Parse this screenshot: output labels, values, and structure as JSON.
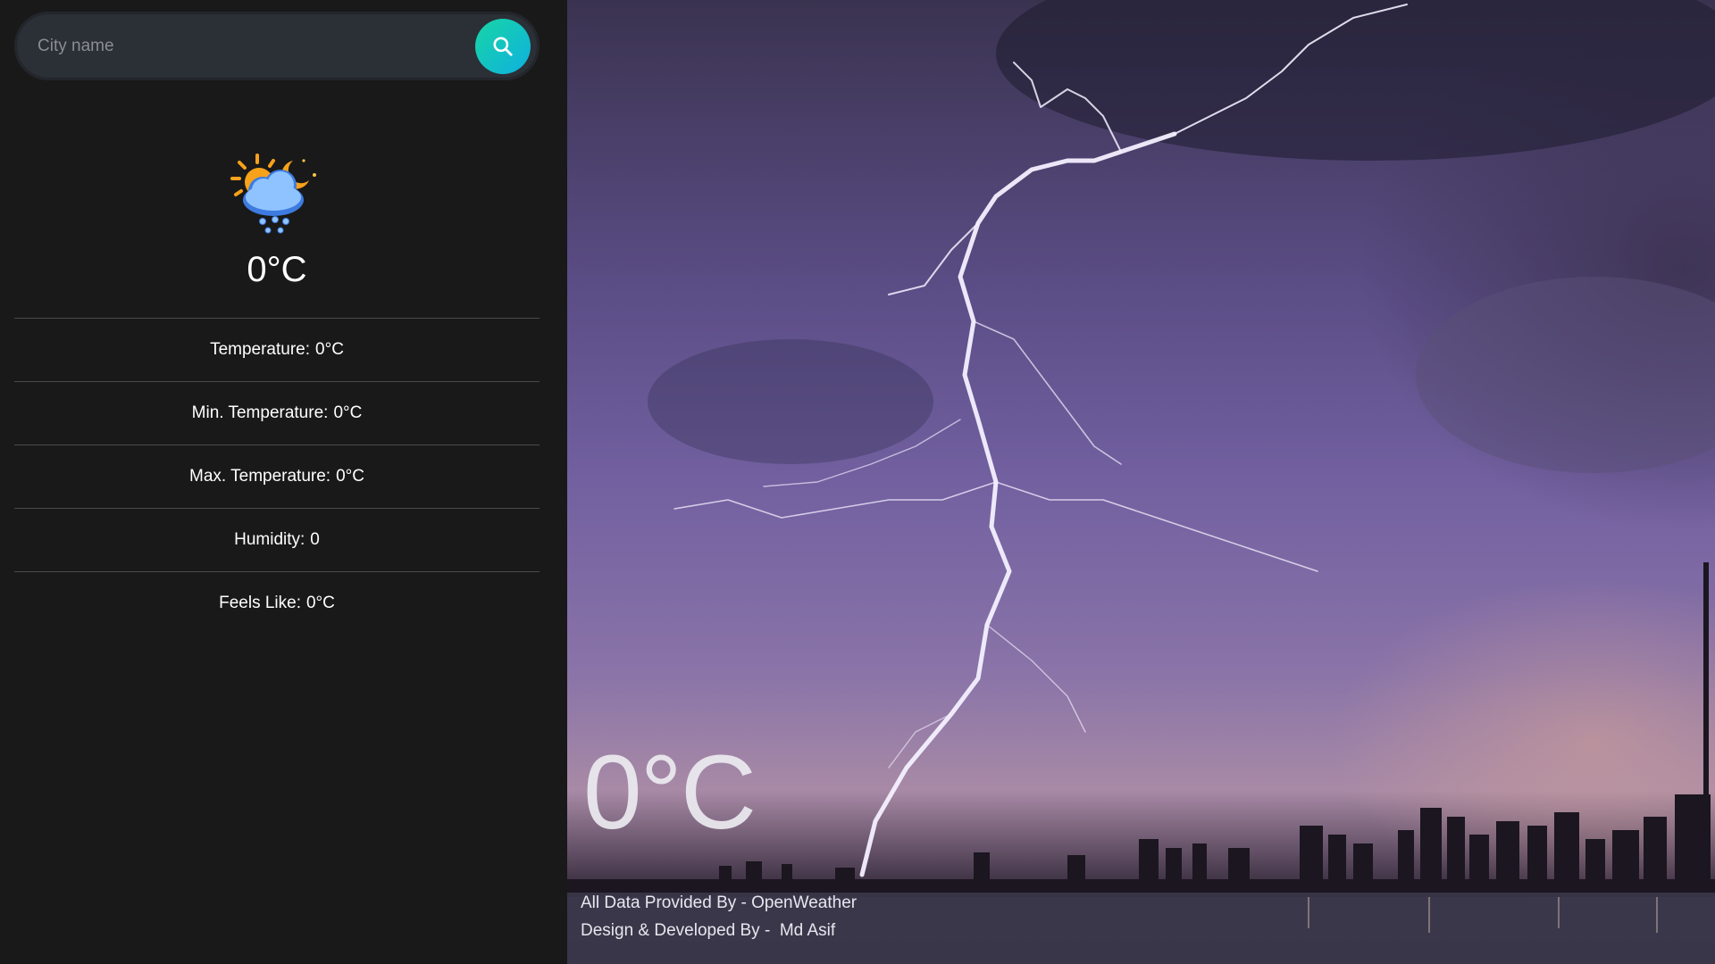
{
  "search": {
    "placeholder": "City name",
    "value": "",
    "button_icon": "search-icon"
  },
  "current": {
    "icon": "cloud-snow-sun-moon-icon",
    "temperature": "0°C"
  },
  "details": [
    {
      "label": "Temperature:",
      "value": "0°C"
    },
    {
      "label": "Min. Temperature:",
      "value": "0°C"
    },
    {
      "label": "Max. Temperature:",
      "value": "0°C"
    },
    {
      "label": "Humidity:",
      "value": "0"
    },
    {
      "label": "Feels Like:",
      "value": "0°C"
    }
  ],
  "hero": {
    "temperature": "0°C",
    "background": "lightning-storm-city-skyline"
  },
  "credits": {
    "data_prefix": "All Data Provided By - ",
    "data_source": "OpenWeather",
    "design_prefix": "Design & Developed By -  ",
    "author": "Md Asif"
  },
  "colors": {
    "sidebar_bg": "#191919",
    "search_bg": "#2b2f36",
    "accent_start": "#17d6a4",
    "accent_end": "#0fb0e0"
  }
}
